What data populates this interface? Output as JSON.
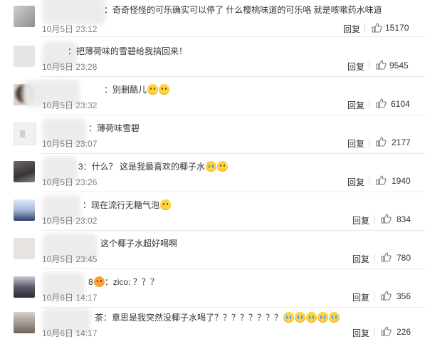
{
  "comments": [
    {
      "text": "：奇奇怪怪的可乐确实可以停了 什么樱桃味道的可乐咯 就是咳嗽药水味道",
      "date": "10月5日 23:12",
      "reply": "回复",
      "likes": "15170",
      "emojis": []
    },
    {
      "text": "：把薄荷味的雪碧给我搞回来！",
      "date": "10月5日 23:28",
      "reply": "回复",
      "likes": "9545",
      "emojis": []
    },
    {
      "text": "：别删酷儿",
      "date": "10月5日 23:32",
      "reply": "回复",
      "likes": "6104",
      "emojis": [
        "sad-emoji",
        "sad-emoji"
      ]
    },
    {
      "text": "：薄荷味雪碧",
      "date": "10月5日 23:07",
      "reply": "回复",
      "likes": "2177",
      "emojis": []
    },
    {
      "text": "3：什么？ 这是我最喜欢的椰子水",
      "date": "10月5日 23:26",
      "reply": "回复",
      "likes": "1940",
      "emojis": [
        "crying-emoji",
        "sweat-emoji"
      ]
    },
    {
      "text": "：现在流行无糖气泡",
      "date": "10月5日 23:02",
      "reply": "回复",
      "likes": "834",
      "emojis": [
        "smile-emoji"
      ]
    },
    {
      "text": "这个椰子水超好喝啊",
      "date": "10月5日 23:45",
      "reply": "回复",
      "likes": "780",
      "emojis": []
    },
    {
      "text": "8",
      "text2": "：zico: ？？？",
      "date": "10月6日 14:17",
      "reply": "回复",
      "likes": "356",
      "emojis": [
        "heart-eyes-emoji"
      ]
    },
    {
      "text": "茶：意思是我突然没椰子水喝了？？？？？？？？",
      "date": "10月6日 14:17",
      "reply": "回复",
      "likes": "226",
      "emojis": [
        "crying-emoji",
        "crying-emoji",
        "crying-emoji",
        "crying-emoji",
        "crying-emoji"
      ]
    }
  ],
  "colors": {
    "text": "#333333",
    "date": "#808080",
    "separator": "#e9e9e9"
  },
  "icons": {
    "like": "thumbs-up-icon"
  }
}
